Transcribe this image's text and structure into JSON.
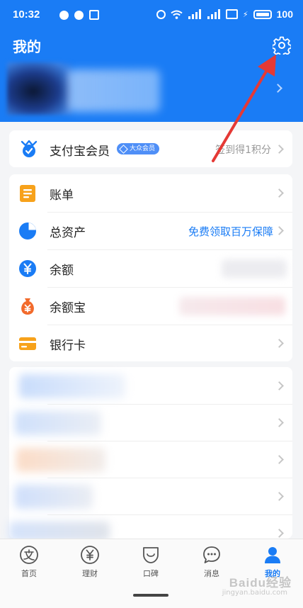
{
  "status_bar": {
    "time": "10:32",
    "battery": "100",
    "icons": [
      "alarm-icon",
      "wifi-icon",
      "signal-icon",
      "signal-icon",
      "sim-icon",
      "charging-icon",
      "battery-icon"
    ]
  },
  "header": {
    "title": "我的",
    "settings_icon": "gear-icon",
    "background_color": "#1a7cf5"
  },
  "member": {
    "label": "支付宝会员",
    "badge": "大众会员",
    "action": "签到得1积分"
  },
  "main_list": {
    "items": [
      {
        "label": "账单",
        "icon": "bill-icon",
        "icon_color": "#f7a21b"
      },
      {
        "label": "总资产",
        "icon": "pie-chart-icon",
        "icon_color": "#1a7cf5",
        "promo": "免费领取百万保障"
      },
      {
        "label": "余额",
        "icon": "yuan-coin-icon",
        "icon_color": "#1a7cf5"
      },
      {
        "label": "余额宝",
        "icon": "money-bag-icon",
        "icon_color": "#f26a2b"
      },
      {
        "label": "银行卡",
        "icon": "bank-card-icon",
        "icon_color": "#f7a21b"
      }
    ]
  },
  "bottom_nav": {
    "items": [
      {
        "label": "首页",
        "icon": "alipay-home-icon"
      },
      {
        "label": "理财",
        "icon": "yuan-circle-icon"
      },
      {
        "label": "口碑",
        "icon": "koubei-icon"
      },
      {
        "label": "消息",
        "icon": "chat-bubble-icon"
      },
      {
        "label": "我的",
        "icon": "person-icon",
        "active": true
      }
    ]
  },
  "watermark": {
    "text": "Baidu经验",
    "sub": "jingyan.baidu.com"
  },
  "annotation_color": "#e53935",
  "accent_color": "#1a7cf5"
}
